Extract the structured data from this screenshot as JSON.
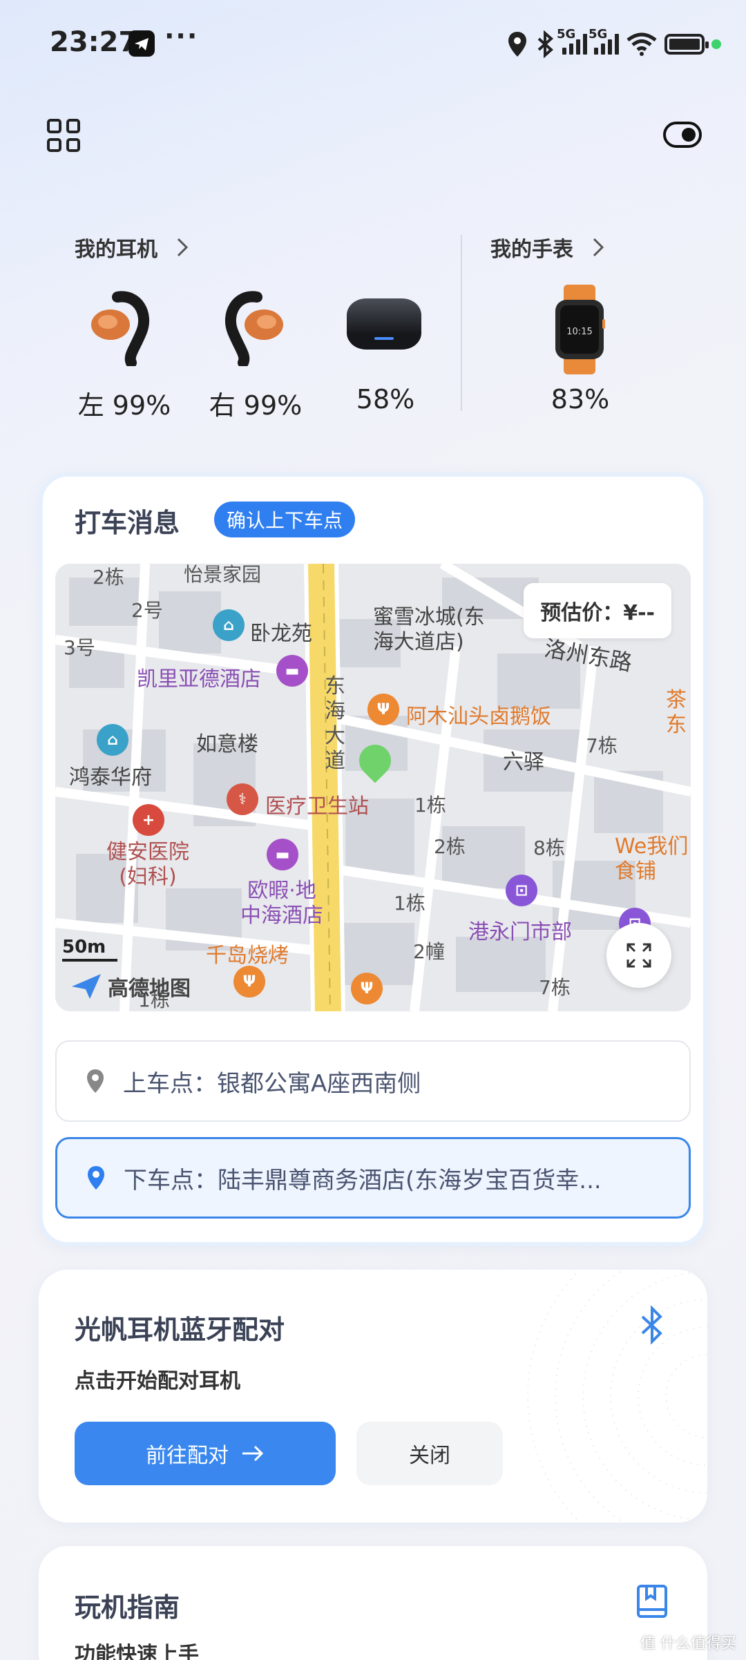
{
  "status_bar": {
    "time": "23:27",
    "dots": "···",
    "network_tag_1": "5G",
    "network_tag_2": "5G",
    "wifi_sub": "6"
  },
  "devices": {
    "earphones_title": "我的耳机",
    "watch_title": "我的手表",
    "left_label": "左 99%",
    "right_label": "右 99%",
    "case_label": "58%",
    "watch_label": "83%",
    "watch_time": "10:15"
  },
  "taxi_card": {
    "title": "打车消息",
    "badge": "确认上下车点",
    "price": "预估价：¥--",
    "pickup_label": "上车点：银都公寓A座西南侧",
    "dropoff_label": "下车点：陆丰鼎尊商务酒店(东海岁宝百货幸..."
  },
  "map": {
    "labels": {
      "l1": "2栋",
      "l2": "怡景家园",
      "l3": "2号",
      "l4": "3号",
      "l5": "卧龙苑",
      "l6": "蜜雪冰城(东\n海大道店)",
      "l7": "洛州东路",
      "l8": "凯里亚德酒店",
      "l9": "东\n海\n大\n道",
      "l10": "阿木汕头卤鹅饭",
      "l11": "茶\n东",
      "l12": "如意楼",
      "l13": "鸿泰华府",
      "l14": "六驿",
      "l15": "7栋",
      "l16": "医疗卫生站",
      "l17": "1栋",
      "l18": "健安医院\n(妇科)",
      "l19": "2栋",
      "l20": "8栋",
      "l21": "We我们\n食铺",
      "l22": "欧暇·地\n中海酒店",
      "l23": "1栋",
      "l24": "港永门市部",
      "l25": "千岛烧烤",
      "l26": "2幢",
      "l27": "7栋",
      "l28": "1栋",
      "scale": "50m",
      "brand": "高德地图"
    }
  },
  "pairing_card": {
    "title": "光帆耳机蓝牙配对",
    "subtitle": "点击开始配对耳机",
    "primary_button": "前往配对",
    "secondary_button": "关闭"
  },
  "guide_card": {
    "title": "玩机指南",
    "subtitle": "功能快速上手"
  },
  "watermark": "值 什么值得买",
  "colors": {
    "accent": "#3a88ef",
    "badge": "#2f7ff0",
    "road": "#f7d96a"
  }
}
